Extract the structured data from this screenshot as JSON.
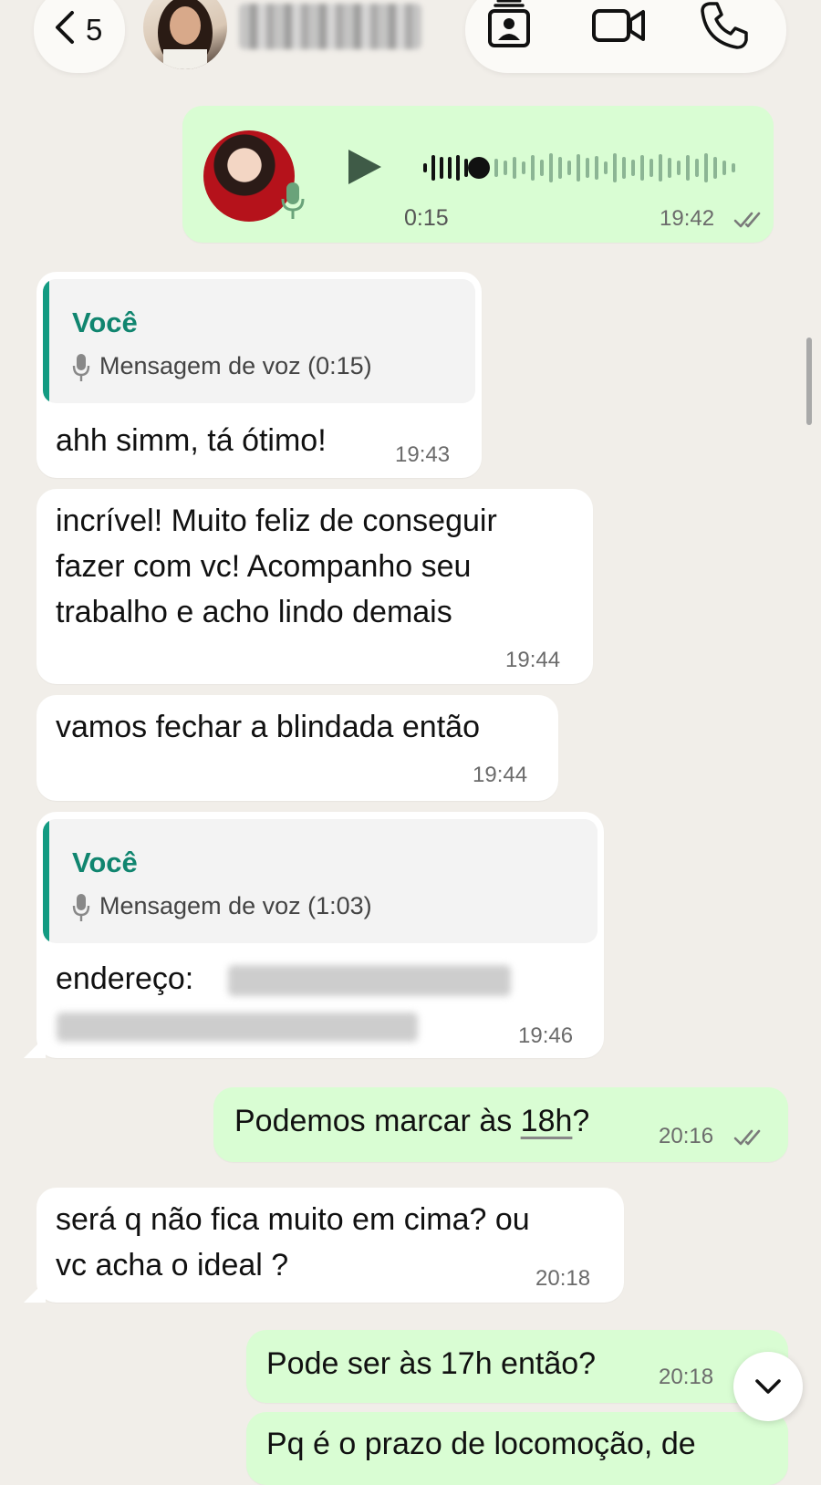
{
  "header": {
    "back_count": "5",
    "contact_name_blurred": true,
    "actions": [
      "contact-card-icon",
      "video-call-icon",
      "phone-call-icon"
    ]
  },
  "colors": {
    "background": "#f1eee9",
    "incoming_bubble": "#ffffff",
    "outgoing_bubble": "#d9fdd3",
    "quote_accent": "#139b82"
  },
  "messages": [
    {
      "direction": "out",
      "type": "voice",
      "duration": "0:15",
      "time": "19:42",
      "status": "read"
    },
    {
      "direction": "in",
      "type": "reply",
      "quote_sender": "Você",
      "quote_body": "Mensagem de voz (0:15)",
      "text": "ahh simm, tá ótimo!",
      "time": "19:43"
    },
    {
      "direction": "in",
      "type": "text",
      "lines": [
        "incrível! Muito feliz de conseguir",
        "fazer com vc! Acompanho seu",
        "trabalho e acho lindo demais"
      ],
      "time": "19:44"
    },
    {
      "direction": "in",
      "type": "text",
      "text": "vamos fechar a blindada então",
      "time": "19:44"
    },
    {
      "direction": "in",
      "type": "reply",
      "quote_sender": "Você",
      "quote_body": "Mensagem de voz (1:03)",
      "text": "endereço:",
      "text_redacted": true,
      "time": "19:46"
    },
    {
      "direction": "out",
      "type": "text",
      "text_before": "Podemos marcar às ",
      "text_link": "18h",
      "text_after": "?",
      "time": "20:16",
      "status": "read"
    },
    {
      "direction": "in",
      "type": "text",
      "lines": [
        "será q não fica muito em cima? ou",
        "vc acha o ideal ?"
      ],
      "time": "20:18"
    },
    {
      "direction": "out",
      "type": "text",
      "text": "Pode ser às 17h então?",
      "time": "20:18"
    },
    {
      "direction": "out",
      "type": "text",
      "text": "Pq é o prazo de locomoção, de"
    }
  ]
}
